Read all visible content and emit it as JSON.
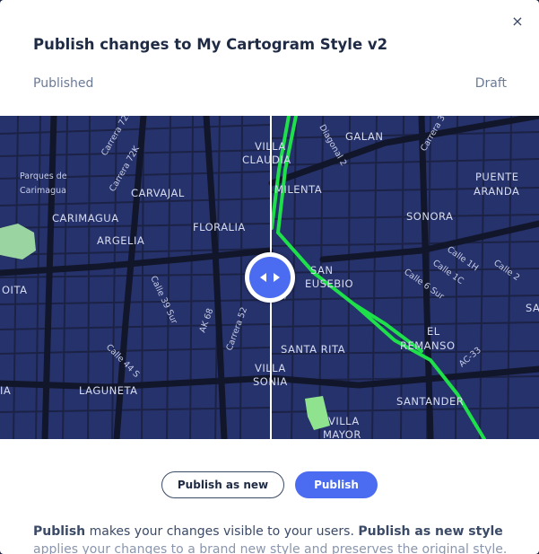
{
  "modal": {
    "title": "Publish changes to My Cartogram Style v2",
    "close_label": "×",
    "left_label": "Published",
    "right_label": "Draft"
  },
  "map": {
    "left_places": [
      "Parques de",
      "Carimagua",
      "CARVAJAL",
      "CARIMAGUA",
      "ARGELIA",
      "FLORALIA",
      "VILLA",
      "CLAUDIA",
      "OITA",
      "LAGUNETA",
      "VILLA",
      "SONIA",
      "IA"
    ],
    "left_streets": [
      "Carrera 72N",
      "Carrera 72K",
      "Calle 39 Sur",
      "AK 68",
      "Carrera 52",
      "Calle 44 S"
    ],
    "right_places": [
      "GALAN",
      "MILENTA",
      "PUENTE",
      "ARANDA",
      "SONORA",
      "SAN",
      "EUSEBIO",
      "EL",
      "REMANSO",
      "SANTA RITA",
      "SANTANDER",
      "VILLA",
      "MAYOR",
      "SA"
    ],
    "right_streets": [
      "Diagonal 2",
      "Carrera 3",
      "Calle 1H",
      "Calle 1C",
      "Calle 6 Sur",
      "Calle 2",
      "AC-33",
      "Sur"
    ],
    "colors": {
      "water": "#2c3a72",
      "land": "#2a3570",
      "road": "#161a30",
      "park": "#9ad4a0",
      "highlight": "#1ee04a"
    }
  },
  "slider": {
    "handle_icon": "compare-arrows-icon"
  },
  "actions": {
    "publish_new_label": "Publish as new",
    "publish_label": "Publish"
  },
  "description": {
    "term1": "Publish",
    "text1": " makes your changes visible to your users. ",
    "term2": "Publish as new style",
    "line2": "applies your changes to a brand new style and preserves the original style."
  }
}
